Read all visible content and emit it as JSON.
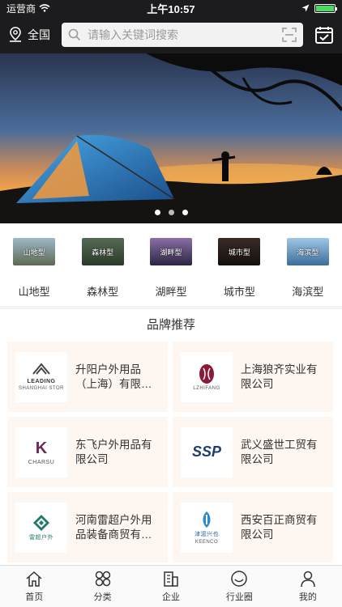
{
  "status": {
    "carrier": "运营商",
    "time": "上午10:57"
  },
  "header": {
    "location": "全国",
    "search_placeholder": "请输入关键词搜索"
  },
  "banner": {
    "dots": 3,
    "active_dot": 0
  },
  "categories": [
    {
      "thumb": "山地型",
      "label": "山地型"
    },
    {
      "thumb": "森林型",
      "label": "森林型"
    },
    {
      "thumb": "湖畔型",
      "label": "湖畔型"
    },
    {
      "thumb": "城市型",
      "label": "城市型"
    },
    {
      "thumb": "海滨型",
      "label": "海滨型"
    }
  ],
  "brands": {
    "title": "品牌推荐",
    "items": [
      {
        "name": "升阳户外用品（上海）有限公司",
        "logo_text": "LEADING",
        "logo_sub": "SHANGHAI STOR"
      },
      {
        "name": "上海狼齐实业有限公司",
        "logo_text": "LZHIFANG",
        "logo_sub": ""
      },
      {
        "name": "东飞户外用品有限公司",
        "logo_text": "CHARSU",
        "logo_sub": ""
      },
      {
        "name": "武义盛世工贸有限公司",
        "logo_text": "SSP",
        "logo_sub": ""
      },
      {
        "name": "河南雷超户外用品装备商贸有限公司",
        "logo_text": "雷超户外",
        "logo_sub": ""
      },
      {
        "name": "西安百正商贸有限公司",
        "logo_text": "津滬兴也",
        "logo_sub": "KEENCO"
      }
    ]
  },
  "tabs": [
    {
      "label": "首页",
      "icon": "home-icon"
    },
    {
      "label": "分类",
      "icon": "category-icon"
    },
    {
      "label": "企业",
      "icon": "company-icon"
    },
    {
      "label": "行业圈",
      "icon": "circle-icon"
    },
    {
      "label": "我的",
      "icon": "user-icon"
    }
  ],
  "colors": {
    "accent": "#ffffff",
    "card_bg": "#fdf6f1",
    "header_bg": "#1c1c1e"
  }
}
